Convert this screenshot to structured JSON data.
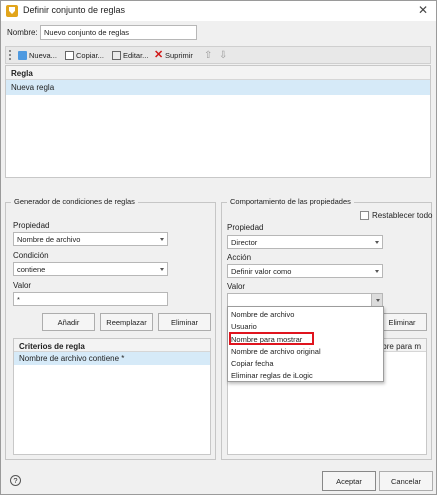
{
  "window": {
    "title": "Definir conjunto de reglas",
    "close_glyph": "✕"
  },
  "name_field": {
    "label": "Nombre:",
    "value": "Nuevo conjunto de reglas"
  },
  "toolbar": {
    "new_label": "Nueva...",
    "copy_label": "Copiar...",
    "edit_label": "Editar...",
    "delete_label": "Suprimir",
    "up_glyph": "⇧",
    "down_glyph": "⇩"
  },
  "rule_grid": {
    "header": "Regla",
    "rows": [
      "Nueva regla"
    ]
  },
  "condition_builder": {
    "title": "Generador de condiciones de reglas",
    "property_label": "Propiedad",
    "property_value": "Nombre de archivo",
    "condition_label": "Condición",
    "condition_value": "contiene",
    "value_label": "Valor",
    "value_text": "*",
    "add_label": "Añadir",
    "replace_label": "Reemplazar",
    "remove_label": "Eliminar",
    "criteria_header": "Criterios de regla",
    "criteria_rows": [
      "Nombre de archivo contiene *"
    ]
  },
  "property_behavior": {
    "title": "Comportamiento de las propiedades",
    "reset_all_label": "Restablecer todo",
    "property_label": "Propiedad",
    "property_value": "Director",
    "action_label": "Acción",
    "action_value": "Definir valor como",
    "value_label": "Valor",
    "value_text": "",
    "remove_label": "Eliminar",
    "grid_header_partial": "mbre para m",
    "value_options": [
      "Nombre de archivo",
      "Usuario",
      "Nombre para mostrar",
      "Nombre de archivo original",
      "Copiar fecha",
      "Eliminar reglas de iLogic"
    ],
    "highlighted_option": "Nombre para mostrar"
  },
  "footer": {
    "help_glyph": "?",
    "accept_label": "Aceptar",
    "cancel_label": "Cancelar"
  }
}
